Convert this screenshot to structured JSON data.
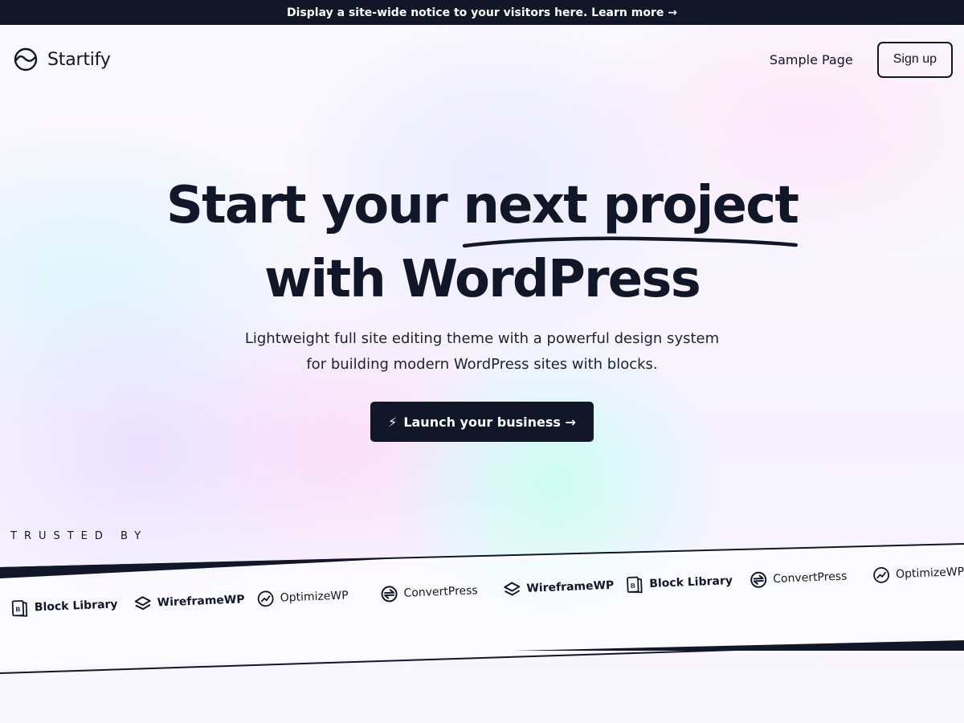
{
  "notice": {
    "text": "Display a site-wide notice to your visitors here. Learn more →"
  },
  "header": {
    "brand_name": "Startify",
    "nav_sample_page": "Sample Page",
    "signup_label": "Sign up"
  },
  "hero": {
    "title_start": "Start your ",
    "title_highlight": "next project",
    "title_line2": "with WordPress",
    "subtitle_line1": "Lightweight full site editing theme with a powerful design system",
    "subtitle_line2": "for building modern WordPress sites with blocks.",
    "cta_label": "Launch your business →",
    "cta_icon": "lightning-bolt-icon"
  },
  "trusted": {
    "label": "TRUSTED BY",
    "logos": [
      {
        "name": "Block Library",
        "icon": "block-library-icon"
      },
      {
        "name": "WireframeWP",
        "icon": "layers-icon"
      },
      {
        "name": "OptimizeWP",
        "icon": "trend-circle-icon"
      },
      {
        "name": "ConvertPress",
        "icon": "convert-circle-icon"
      },
      {
        "name": "WireframeWP",
        "icon": "layers-icon"
      },
      {
        "name": "Block Library",
        "icon": "block-library-icon"
      },
      {
        "name": "ConvertPress",
        "icon": "convert-circle-icon"
      },
      {
        "name": "OptimizeWP",
        "icon": "trend-circle-icon"
      }
    ]
  },
  "colors": {
    "dark": "#111629",
    "white": "#ffffff"
  }
}
